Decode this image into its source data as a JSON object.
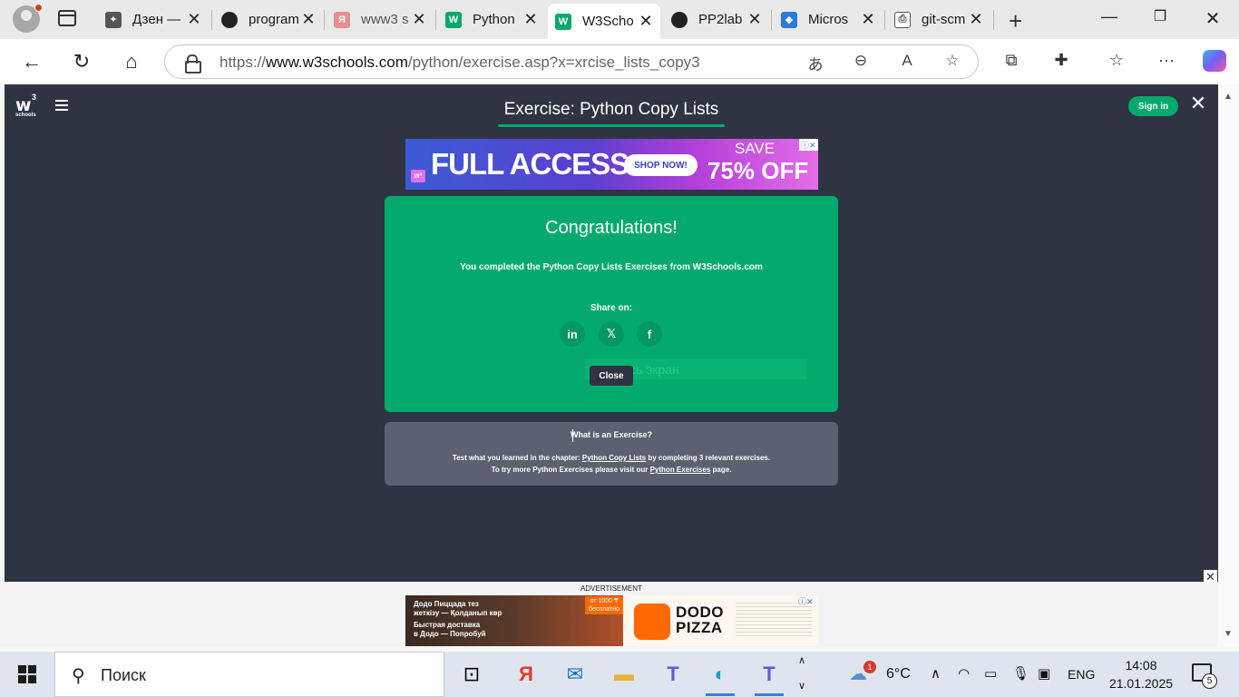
{
  "browser": {
    "tabs": [
      {
        "title": "Дзен — ",
        "favicon_color": "#555555",
        "favicon": "✦"
      },
      {
        "title": "program",
        "favicon_color": "#222222",
        "favicon": "●"
      },
      {
        "title": "www3 s",
        "favicon_color": "#e87c7c",
        "favicon": "Я"
      },
      {
        "title": "Python ",
        "favicon_color": "#04aa6d",
        "favicon": "W"
      },
      {
        "title": "W3Scho",
        "favicon_color": "#04aa6d",
        "favicon": "W",
        "active": true
      },
      {
        "title": "PP2lab",
        "favicon_color": "#222222",
        "favicon": "●"
      },
      {
        "title": "Micros",
        "favicon_color": "#2b7bd6",
        "favicon": "◆"
      },
      {
        "title": "git-scm",
        "favicon_color": "#777777",
        "favicon": "⎙"
      }
    ],
    "url_prefix": "https://",
    "url_host": "www.w3schools.com",
    "url_path": "/python/exercise.asp?x=xrcise_lists_copy3"
  },
  "page": {
    "title": "Exercise: Python Copy Lists",
    "signin_label": "Sign in",
    "logo_text": "w",
    "logo_sup": "3",
    "logo_schools": "schools",
    "banner": {
      "headline": "FULL ACCESS",
      "shop_label": "SHOP NOW!",
      "save_label": "SAVE",
      "off_label": "75% OFF"
    },
    "congrats": {
      "heading": "Congratulations!",
      "message": "You completed the Python Copy Lists Exercises from W3Schools.com",
      "share_label": "Share on:",
      "fullscreen_hint": "весь экран",
      "close_label": "Close"
    },
    "info": {
      "question": "What is an Exercise?",
      "line1_pre": "Test what you learned in the chapter: ",
      "line1_link": "Python Copy Lists",
      "line1_post": " by completing 3 relevant exercises.",
      "line2_pre": "To try more Python Exercises please visit our ",
      "line2_link": "Python Exercises",
      "line2_post": " page."
    }
  },
  "ad": {
    "label": "ADVERTISEMENT",
    "line1": "Додо Пиццада тез",
    "line2": "жеткізу — Қолданып көр",
    "line3": "Быстрая доставка",
    "line4": "в Додо — Попробуй",
    "badge": "от 1000 ₸ бесплатно",
    "brand1": "DODO",
    "brand2": "PIZZA"
  },
  "taskbar": {
    "search_placeholder": "Поиск",
    "weather_temp": "6°C",
    "weather_badge": "1",
    "language": "ENG",
    "time": "14:08",
    "date": "21.01.2025",
    "notification_count": "5"
  },
  "colors": {
    "accent": "#04aa6d",
    "page_bg": "#2f3443",
    "info_bg": "#5b6170"
  }
}
